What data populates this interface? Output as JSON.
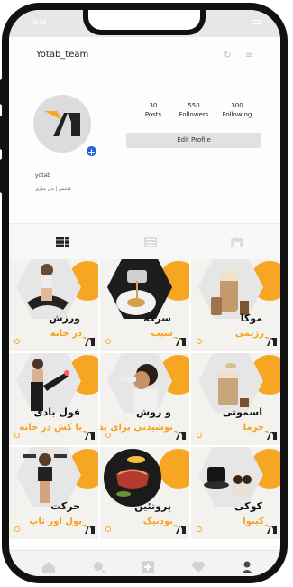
{
  "status": {
    "time": "08:28"
  },
  "header": {
    "username": "Yotab_team",
    "refresh_icon": "refresh-icon",
    "menu_icon": "menu-icon"
  },
  "profile": {
    "stats": [
      {
        "num": "30",
        "label": "Posts"
      },
      {
        "num": "550",
        "label": "Followers"
      },
      {
        "num": "300",
        "label": "Following"
      }
    ],
    "edit_label": "Edit Profile",
    "name": "yotab",
    "bio": "فیتنس | بدن سازی"
  },
  "tabs": [
    {
      "icon": "grid-icon"
    },
    {
      "icon": "reels-icon"
    },
    {
      "icon": "tagged-icon"
    }
  ],
  "posts": [
    {
      "line1": "ورزش",
      "line2": "در خانه"
    },
    {
      "line1": "سرکه",
      "line2": "سیب"
    },
    {
      "line1": "موکا",
      "line2": "رژیمی"
    },
    {
      "line1": "فول بادی",
      "line2": "با کش در خانه"
    },
    {
      "line1": "و روش",
      "line2": "نوشیدنی برای بدن"
    },
    {
      "line1": "اسموتی",
      "line2": "خرما"
    },
    {
      "line1": "حرکت",
      "line2": "پول اور تاپ"
    },
    {
      "line1": "پروتئین",
      "line2": "نودنیک"
    },
    {
      "line1": "کوکی",
      "line2": "کینوا"
    }
  ],
  "bottom_nav": [
    {
      "icon": "home-icon"
    },
    {
      "icon": "search-icon"
    },
    {
      "icon": "add-post-icon"
    },
    {
      "icon": "heart-icon"
    },
    {
      "icon": "profile-icon"
    }
  ],
  "colors": {
    "accent": "#f6a623",
    "brand_blue": "#2166d9"
  }
}
